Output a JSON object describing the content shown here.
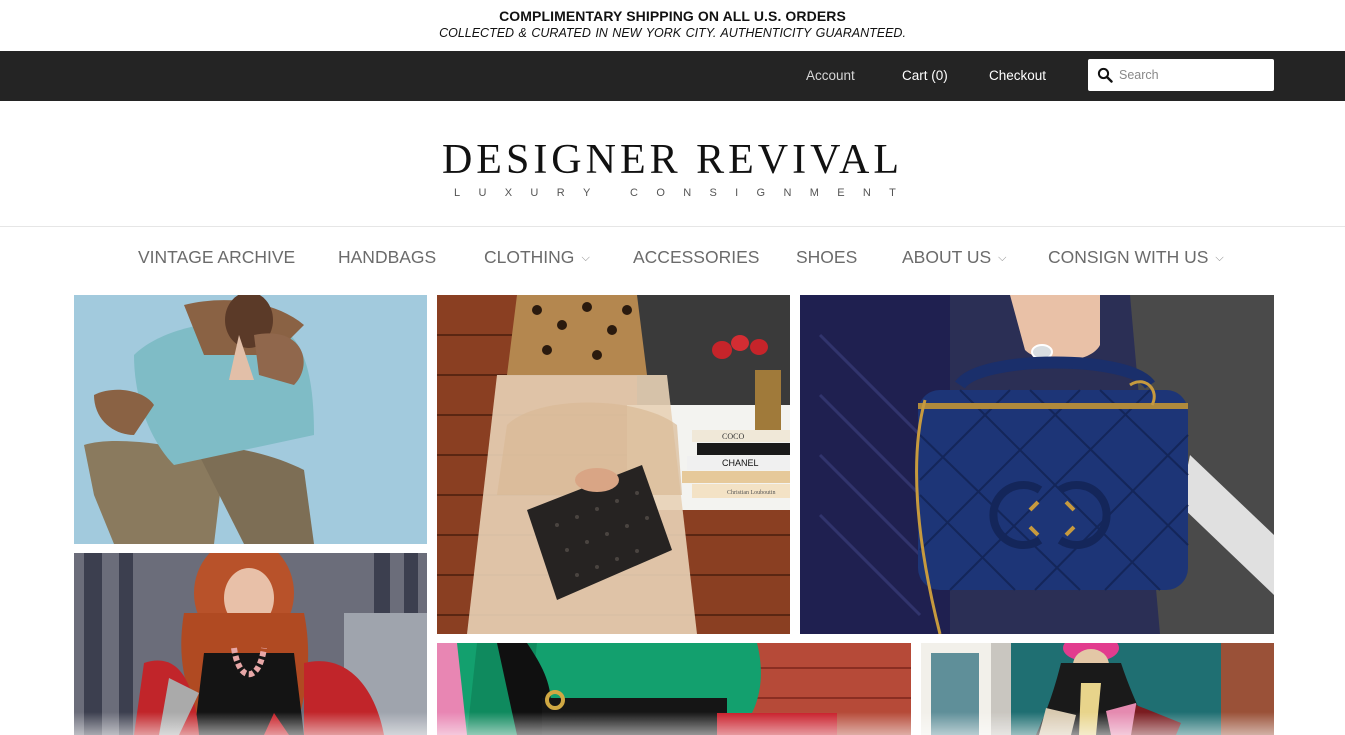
{
  "announcement": {
    "line1": "COMPLIMENTARY SHIPPING ON ALL U.S. ORDERS",
    "line2": "COLLECTED & CURATED IN NEW YORK CITY.   AUTHENTICITY GUARANTEED."
  },
  "topbar": {
    "account": "Account",
    "cart": "Cart (0)",
    "checkout": "Checkout",
    "search_placeholder": "Search"
  },
  "logo": {
    "title": "DESIGNER REVIVAL",
    "subtitle_letters": [
      "L",
      "U",
      "X",
      "U",
      "R",
      "Y",
      "",
      "C",
      "O",
      "N",
      "S",
      "I",
      "G",
      "N",
      "M",
      "E",
      "N",
      "T"
    ]
  },
  "nav": {
    "items": [
      {
        "label": "VINTAGE ARCHIVE",
        "has_dropdown": false
      },
      {
        "label": "HANDBAGS",
        "has_dropdown": false
      },
      {
        "label": "CLOTHING",
        "has_dropdown": true
      },
      {
        "label": "ACCESSORIES",
        "has_dropdown": false
      },
      {
        "label": "SHOES",
        "has_dropdown": false
      },
      {
        "label": "ABOUT US",
        "has_dropdown": true
      },
      {
        "label": "CONSIGN WITH US",
        "has_dropdown": true
      }
    ]
  },
  "gallery": {
    "books": [
      "COCO",
      "CHANEL",
      "Christian Louboutin"
    ],
    "colors": {
      "topbar": "#242424",
      "nav_text": "#6b6b6b",
      "navy_bag": "#1d3577",
      "sky": "#a9cfe0"
    }
  }
}
